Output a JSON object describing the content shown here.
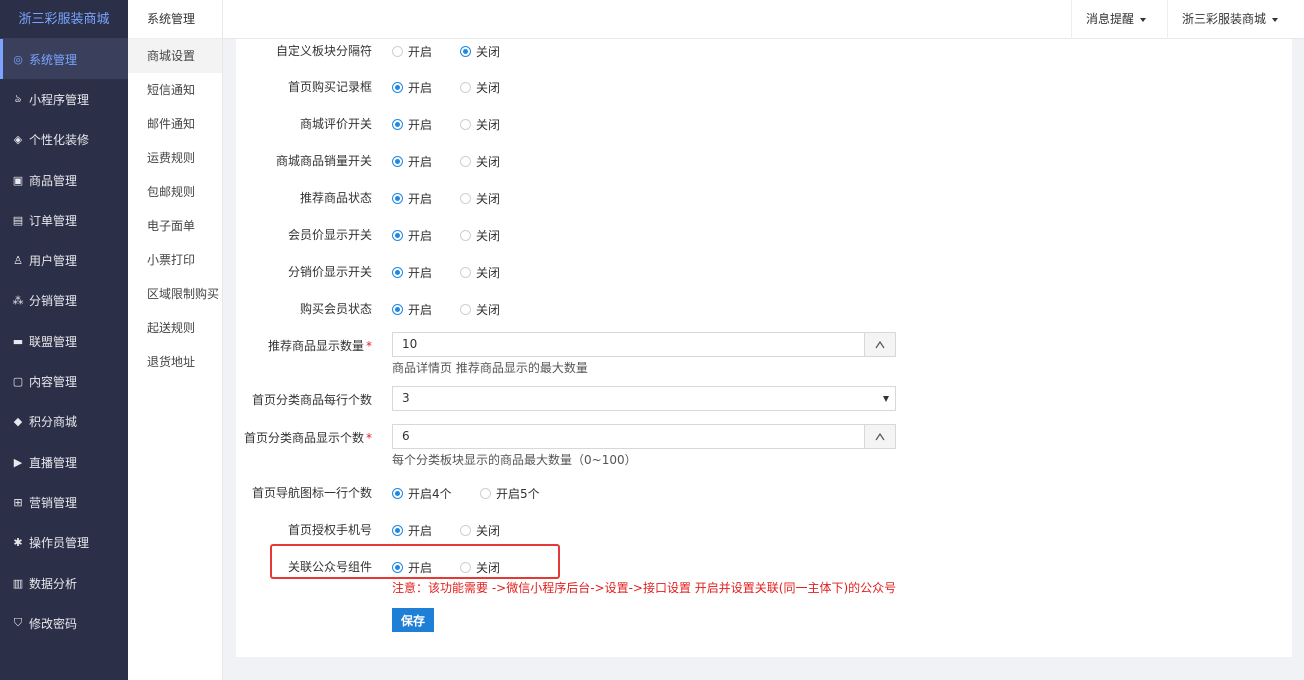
{
  "brand": "浙三彩服装商城",
  "sidebar": {
    "items": [
      {
        "label": "系统管理",
        "icon": "gear-icon",
        "glyph": "◎",
        "active": true
      },
      {
        "label": "小程序管理",
        "icon": "miniprogram-icon",
        "glyph": "ঌ"
      },
      {
        "label": "个性化装修",
        "icon": "decoration-icon",
        "glyph": "◈"
      },
      {
        "label": "商品管理",
        "icon": "bag-icon",
        "glyph": "▣"
      },
      {
        "label": "订单管理",
        "icon": "order-icon",
        "glyph": "▤"
      },
      {
        "label": "用户管理",
        "icon": "user-icon",
        "glyph": "♙"
      },
      {
        "label": "分销管理",
        "icon": "sitemap-icon",
        "glyph": "⁂"
      },
      {
        "label": "联盟管理",
        "icon": "store-icon",
        "glyph": "▬"
      },
      {
        "label": "内容管理",
        "icon": "content-icon",
        "glyph": "▢"
      },
      {
        "label": "积分商城",
        "icon": "cube-icon",
        "glyph": "◆"
      },
      {
        "label": "直播管理",
        "icon": "play-icon",
        "glyph": "▶"
      },
      {
        "label": "营销管理",
        "icon": "marketing-icon",
        "glyph": "⊞"
      },
      {
        "label": "操作员管理",
        "icon": "cog-icon",
        "glyph": "✱"
      },
      {
        "label": "数据分析",
        "icon": "bar-chart-icon",
        "glyph": "▥"
      },
      {
        "label": "修改密码",
        "icon": "shield-icon",
        "glyph": "⛉"
      }
    ]
  },
  "subnav": {
    "title": "系统管理",
    "items": [
      "商城设置",
      "短信通知",
      "邮件通知",
      "运费规则",
      "包邮规则",
      "电子面单",
      "小票打印",
      "区域限制购买",
      "起送规则",
      "退货地址"
    ]
  },
  "topbar": {
    "messages": "消息提醒",
    "shop": "浙三彩服装商城"
  },
  "labels": {
    "on": "开启",
    "off": "关闭",
    "on4": "开启4个",
    "on5": "开启5个"
  },
  "form": {
    "custom_separator": {
      "label": "自定义板块分隔符",
      "value": "off"
    },
    "purchase_record": {
      "label": "首页购买记录框",
      "value": "on"
    },
    "review_switch": {
      "label": "商城评价开关",
      "value": "on"
    },
    "sales_switch": {
      "label": "商城商品销量开关",
      "value": "on"
    },
    "recommend_status": {
      "label": "推荐商品状态",
      "value": "on"
    },
    "member_price": {
      "label": "会员价显示开关",
      "value": "on"
    },
    "distribution_price": {
      "label": "分销价显示开关",
      "value": "on"
    },
    "buy_member": {
      "label": "购买会员状态",
      "value": "on"
    },
    "recommend_count": {
      "label": "推荐商品显示数量",
      "value": "10",
      "hint": "商品详情页 推荐商品显示的最大数量"
    },
    "per_row": {
      "label": "首页分类商品每行个数",
      "value": "3"
    },
    "category_count": {
      "label": "首页分类商品显示个数",
      "value": "6",
      "hint": "每个分类板块显示的商品最大数量（0~100）"
    },
    "nav_icons": {
      "label": "首页导航图标一行个数",
      "value": "4"
    },
    "phone_auth": {
      "label": "首页授权手机号",
      "value": "on"
    },
    "official_account": {
      "label": "关联公众号组件",
      "value": "on",
      "warning": "注意：该功能需要 ->微信小程序后台->设置->接口设置 开启并设置关联(同一主体下)的公众号"
    }
  },
  "save_label": "保存",
  "colors": {
    "sidebar": "#2b2f47",
    "accent": "#1e88e5",
    "highlight": "#e53935"
  }
}
